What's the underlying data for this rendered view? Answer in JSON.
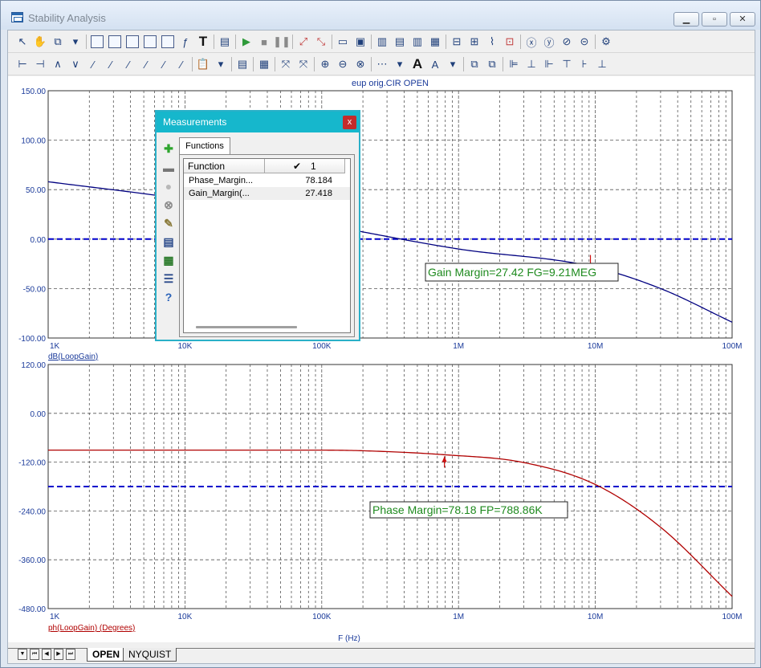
{
  "window": {
    "title": "Stability Analysis"
  },
  "graph": {
    "file_label": "eup orig.CIR OPEN",
    "x_axis": {
      "label": "F (Hz)",
      "ticks": [
        "1K",
        "10K",
        "100K",
        "1M",
        "10M",
        "100M"
      ]
    },
    "top_plot": {
      "y_label": "dB(LoopGain)",
      "y_ticks": [
        "150.00",
        "100.00",
        "50.00",
        "0.00",
        "-50.00",
        "-100.00"
      ]
    },
    "bottom_plot": {
      "y_label": "ph(LoopGain) (Degrees)",
      "y_ticks": [
        "120.00",
        "0.00",
        "-120.00",
        "-240.00",
        "-360.00",
        "-480.00"
      ]
    },
    "annotations": {
      "gain_margin": "Gain Margin=27.42 FG=9.21MEG",
      "phase_margin": "Phase Margin=78.18 FP=788.86K"
    },
    "colors": {
      "gain_curve": "#000080",
      "phase_curve": "#b00000",
      "reference_line": "#0000cc",
      "tick_text": "#1a3a9a",
      "annotation_text": "#1e8a1e"
    }
  },
  "chart_data": [
    {
      "type": "line",
      "x_scale": "log",
      "xlim": [
        1000,
        100000000
      ],
      "ylim": [
        -100,
        150
      ],
      "x": [
        1000,
        10000,
        100000,
        1000000,
        9210000,
        30000000,
        100000000
      ],
      "series": [
        {
          "name": "dB(LoopGain)",
          "values": [
            58,
            40,
            15,
            -10,
            -27.42,
            -50,
            -84
          ]
        },
        {
          "values": [
            0,
            0,
            0,
            0,
            0,
            0,
            0
          ]
        }
      ]
    },
    {
      "type": "line",
      "x_scale": "log",
      "xlim": [
        1000,
        100000000
      ],
      "ylim": [
        -480,
        120
      ],
      "x": [
        1000,
        10000,
        100000,
        200000,
        788860,
        3000000,
        10000000,
        30000000,
        100000000
      ],
      "series": [
        {
          "name": "ph(LoopGain) (Degrees)",
          "values": [
            -90.5,
            -90.5,
            -90.5,
            -92,
            -101.8,
            -121,
            -175,
            -280,
            -450
          ]
        },
        {
          "values": [
            -180,
            -180,
            -180,
            -180,
            -180,
            -180,
            -180,
            -180,
            -180
          ]
        }
      ]
    }
  ],
  "measurements": {
    "title": "Measurements",
    "close_label": "x",
    "tab_label": "Functions",
    "columns": [
      "Function",
      "1"
    ],
    "rows": [
      {
        "function": "Phase_Margin...",
        "value": "78.184"
      },
      {
        "function": "Gain_Margin(...",
        "value": "27.418"
      }
    ],
    "toolbar_icons": [
      "add-icon",
      "remove-icon",
      "disabled-icon",
      "delete-icon",
      "edit-icon",
      "table-icon",
      "excel-icon",
      "list-icon",
      "help-icon"
    ]
  },
  "tabs": [
    {
      "label": "OPEN",
      "active": true
    },
    {
      "label": "NYQUIST",
      "active": false
    }
  ]
}
